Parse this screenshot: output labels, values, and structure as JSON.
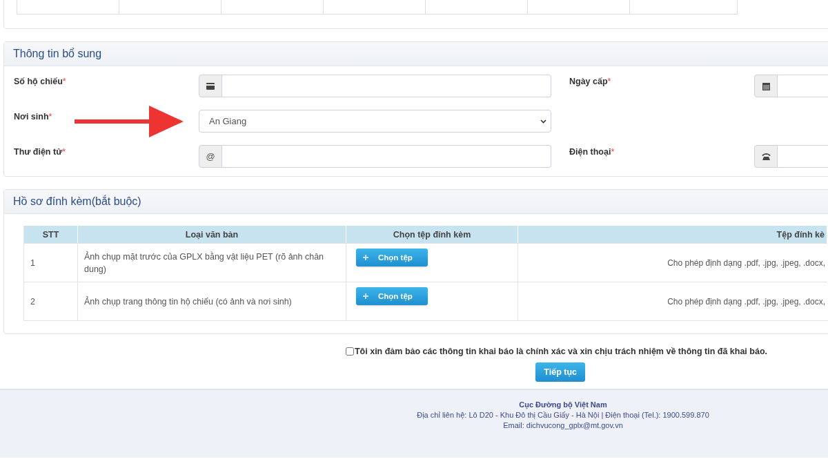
{
  "supplement": {
    "title": "Thông tin bổ sung",
    "fields": [
      {
        "label": "Số hộ chiếu",
        "required_mark": "*",
        "kind": "card"
      },
      {
        "label": "Ngày cấp",
        "required_mark": "*",
        "kind": "date"
      },
      {
        "label": "Nơi sinh",
        "required_mark": "*",
        "kind": "select",
        "value": "An Giang"
      },
      {
        "label": "Thư điện tử",
        "required_mark": "*",
        "kind": "email",
        "addon": "@"
      },
      {
        "label": "Điện thoại",
        "required_mark": "*",
        "kind": "phone"
      }
    ]
  },
  "attachments": {
    "title": "Hồ sơ đính kèm(bắt buộc)",
    "columns": [
      "STT",
      "Loại văn bản",
      "Chọn tệp đính kèm",
      "Tệp đính kè"
    ],
    "rows": [
      {
        "index": "1",
        "document": "Ảnh chụp mặt trước của GPLX bằng vật liệu PET (rõ ảnh chân dung)",
        "button": "Chọn tệp",
        "note": "Cho phép định dạng .pdf, .jpg, .jpeg, .docx,"
      },
      {
        "index": "2",
        "document": "Ảnh chụp trang thông tin hộ chiếu (có ảnh và nơi sinh)",
        "button": "Chọn tệp",
        "note": "Cho phép định dạng .pdf, .jpg, .jpeg, .docx,"
      }
    ]
  },
  "agreement": {
    "text": "Tôi xin đảm bảo các thông tin khai báo là chính xác và xin chịu trách nhiệm về thông tin đã khai báo.",
    "checked": false
  },
  "continue_button": "Tiếp tục",
  "footer": {
    "org": "Cục Đường bộ Việt Nam",
    "address": "Địa chỉ liên hệ: Lô D20 - Khu Đô thị Cầu Giấy - Hà Nội | Điện thoại (Tel.): 1900.599.870",
    "email": "Email: dichvucong_gplx@mt.gov.vn"
  }
}
